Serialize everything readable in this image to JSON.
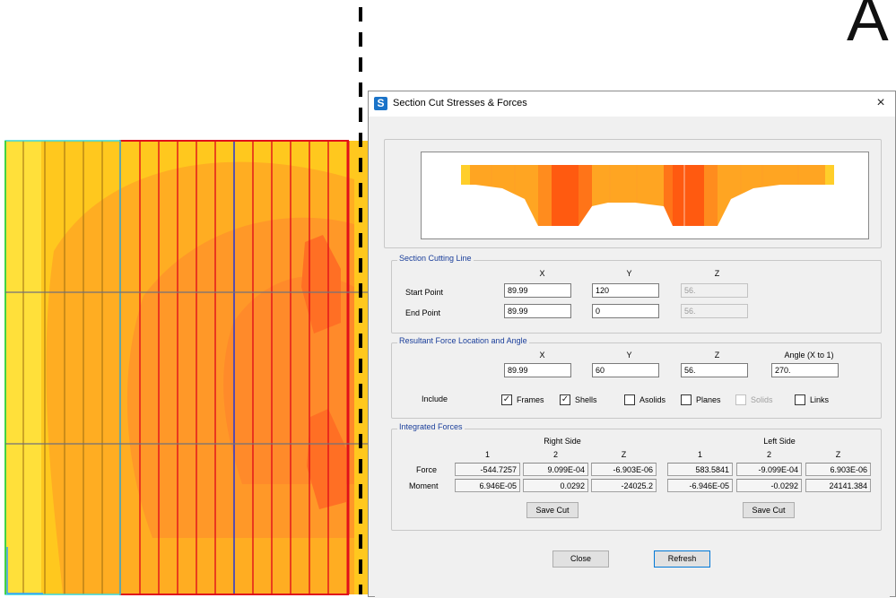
{
  "background_letter": "A",
  "dialog": {
    "title": "Section Cut Stresses & Forces",
    "app_icon_letter": "S",
    "close_glyph": "×"
  },
  "section_cutting_line": {
    "title": "Section Cutting Line",
    "headers": [
      "X",
      "Y",
      "Z"
    ],
    "start_label": "Start Point",
    "end_label": "End Point",
    "start": {
      "x": "89.99",
      "y": "120",
      "z": "56."
    },
    "end": {
      "x": "89.99",
      "y": "0",
      "z": "56."
    }
  },
  "resultant": {
    "title": "Resultant Force Location and Angle",
    "headers": [
      "X",
      "Y",
      "Z",
      "Angle (X to 1)"
    ],
    "values": {
      "x": "89.99",
      "y": "60",
      "z": "56.",
      "angle": "270."
    },
    "include_label": "Include",
    "checks": [
      {
        "label": "Frames",
        "checked": true,
        "enabled": true
      },
      {
        "label": "Shells",
        "checked": true,
        "enabled": true
      },
      {
        "label": "Asolids",
        "checked": false,
        "enabled": true
      },
      {
        "label": "Planes",
        "checked": false,
        "enabled": true
      },
      {
        "label": "Solids",
        "checked": false,
        "enabled": false
      },
      {
        "label": "Links",
        "checked": false,
        "enabled": true
      }
    ]
  },
  "integrated_forces": {
    "title": "Integrated Forces",
    "right_side": "Right Side",
    "left_side": "Left Side",
    "col_headers": [
      "1",
      "2",
      "Z",
      "1",
      "2",
      "Z"
    ],
    "force_label": "Force",
    "moment_label": "Moment",
    "force": [
      "-544.7257",
      "9.099E-04",
      "-6.903E-06",
      "583.5841",
      "-9.099E-04",
      "6.903E-06"
    ],
    "moment": [
      "6.946E-05",
      "0.0292",
      "-24025.2",
      "-6.946E-05",
      "-0.0292",
      "24141.384"
    ],
    "save_cut_label": "Save Cut"
  },
  "buttons": {
    "close": "Close",
    "refresh": "Refresh"
  },
  "colors": {
    "contour_light": "#ffd02e",
    "contour_mid": "#ffb11f",
    "contour_dark": "#ff6a1a",
    "red_line": "#e0101a",
    "blue_line": "#2436d6"
  }
}
